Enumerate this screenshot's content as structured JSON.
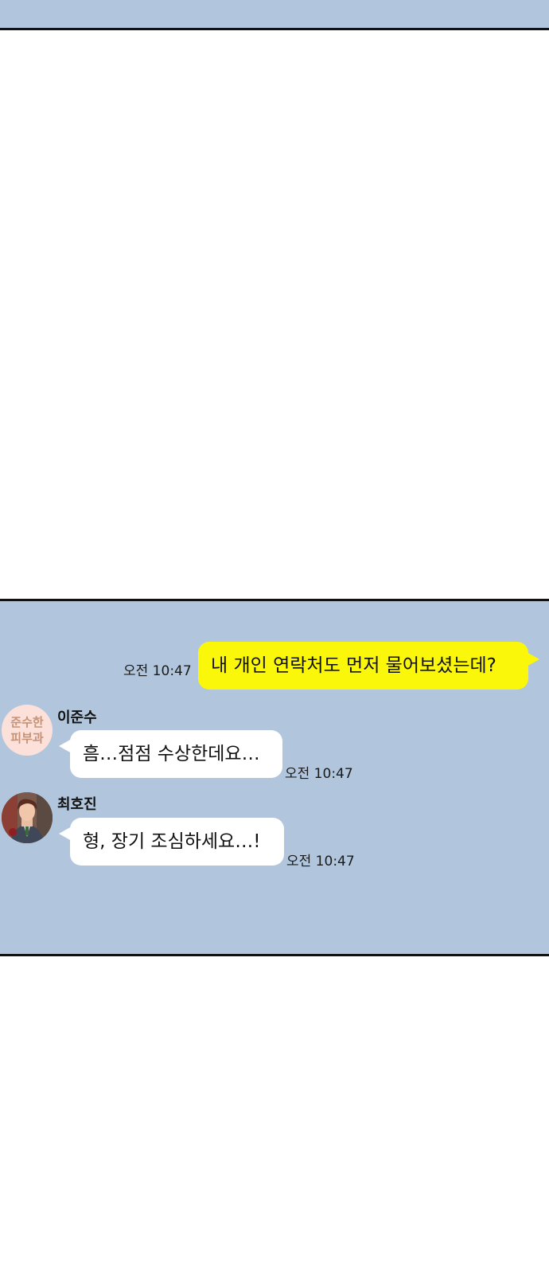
{
  "messages": [
    {
      "id": "m1",
      "side": "outgoing",
      "text": "내 개인 연락처도 먼저 물어보셨는데?",
      "time": "오전 10:47"
    },
    {
      "id": "m2",
      "side": "incoming",
      "sender": "이준수",
      "avatar_text": [
        "준수한",
        "피부과"
      ],
      "text": "흠…점점 수상한데요…",
      "time": "오전 10:47"
    },
    {
      "id": "m3",
      "side": "incoming",
      "sender": "최호진",
      "text": "형, 장기 조심하세요…!",
      "time": "오전 10:47"
    }
  ],
  "colors": {
    "chat_background": "#b1c6dc",
    "outgoing_bubble": "#fbf70b",
    "incoming_bubble": "#ffffff",
    "logo_background": "#fbe1d9",
    "logo_text": "#c79276"
  }
}
